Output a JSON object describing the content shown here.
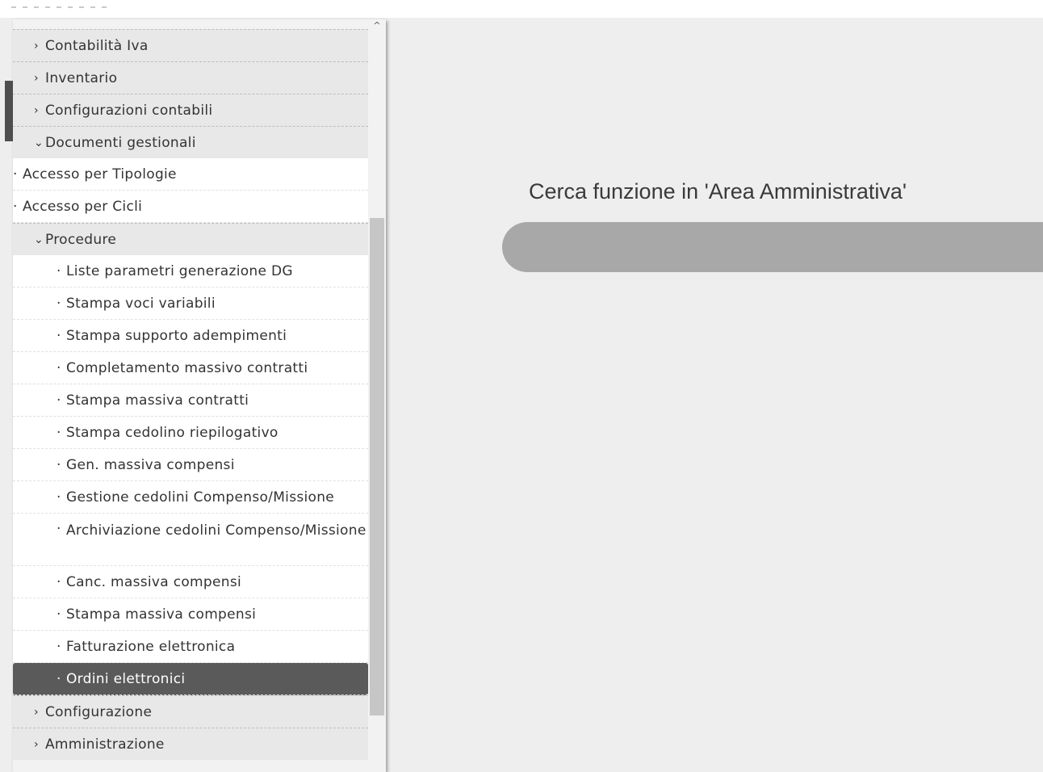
{
  "menu": {
    "items": [
      {
        "level": 1,
        "marker": "›",
        "label": "Contabilità Iva"
      },
      {
        "level": 1,
        "marker": "›",
        "label": "Inventario"
      },
      {
        "level": 1,
        "marker": "›",
        "label": "Configurazioni contabili"
      },
      {
        "level": 1,
        "marker": "⌄",
        "label": "Documenti gestionali"
      },
      {
        "level": 2,
        "marker": "·",
        "label": "Accesso per Tipologie"
      },
      {
        "level": 2,
        "marker": "·",
        "label": "Accesso per Cicli"
      },
      {
        "level": 1,
        "marker": "⌄",
        "label": "Procedure"
      },
      {
        "level": 3,
        "marker": "·",
        "label": "Liste parametri generazione DG"
      },
      {
        "level": 3,
        "marker": "·",
        "label": "Stampa voci variabili"
      },
      {
        "level": 3,
        "marker": "·",
        "label": "Stampa supporto adempimenti"
      },
      {
        "level": 3,
        "marker": "·",
        "label": "Completamento massivo contratti"
      },
      {
        "level": 3,
        "marker": "·",
        "label": "Stampa massiva contratti"
      },
      {
        "level": 3,
        "marker": "·",
        "label": "Stampa cedolino riepilogativo"
      },
      {
        "level": 3,
        "marker": "·",
        "label": "Gen. massiva compensi"
      },
      {
        "level": 3,
        "marker": "·",
        "label": "Gestione cedolini Compenso/Missione"
      },
      {
        "level": 3,
        "marker": "·",
        "label": "Archiviazione cedolini Compenso/Missione",
        "tall": true
      },
      {
        "level": 3,
        "marker": "·",
        "label": "Canc. massiva compensi"
      },
      {
        "level": 3,
        "marker": "·",
        "label": "Stampa massiva compensi"
      },
      {
        "level": 3,
        "marker": "·",
        "label": "Fatturazione elettronica"
      },
      {
        "level": 3,
        "marker": "·",
        "label": "Ordini elettronici",
        "selected": true
      },
      {
        "level": 1,
        "marker": "›",
        "label": "Configurazione"
      },
      {
        "level": 1,
        "marker": "›",
        "label": "Amministrazione"
      }
    ]
  },
  "search": {
    "title": "Cerca funzione in 'Area Amministrativa'",
    "placeholder": "",
    "value": ""
  },
  "colors": {
    "selected_bg": "#5a5a5a",
    "search_bar": "#a8a8a8",
    "page_bg": "#eeeeee"
  }
}
